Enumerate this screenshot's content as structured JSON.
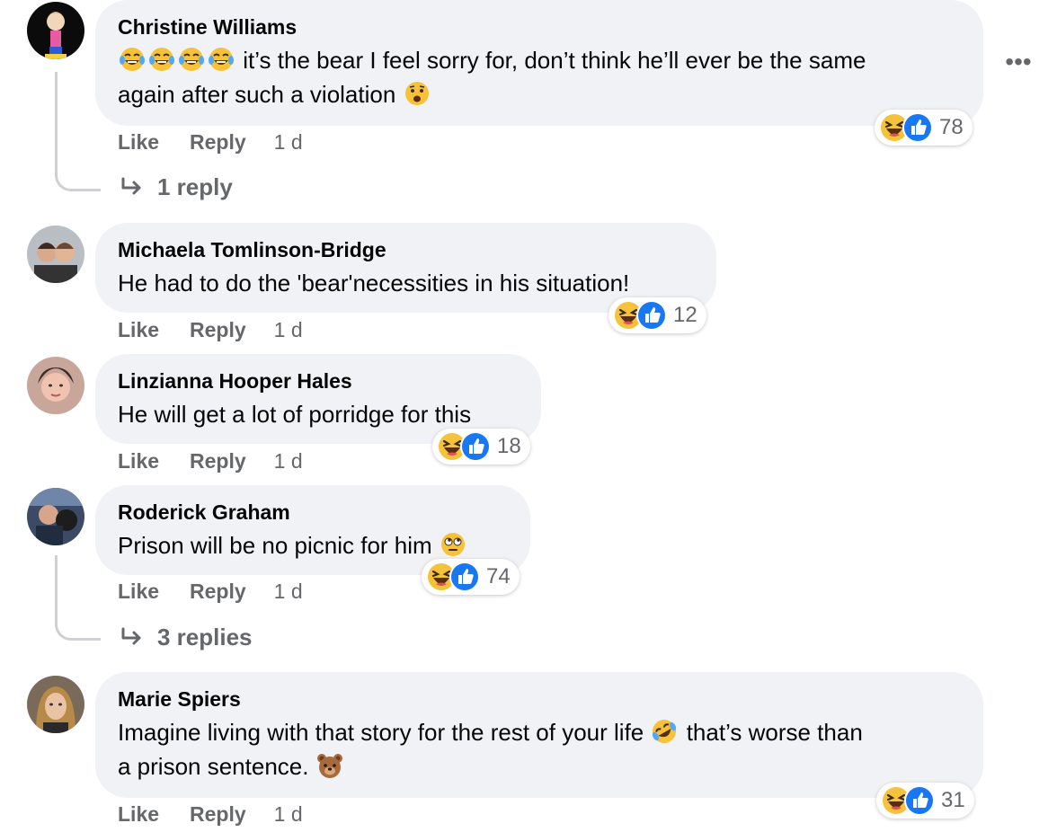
{
  "comments": [
    {
      "author": "Christine Williams",
      "text_emoji_prefix": "😂😂😂😂",
      "text_line1": " it’s the bear I feel sorry for, don’t think he’ll ever be the same",
      "text_line2": "again after such a violation ",
      "text_emoji_suffix": "😧",
      "reaction_count": "78",
      "like_label": "Like",
      "reply_label": "Reply",
      "time": "1 d",
      "replies_label": "1 reply"
    },
    {
      "author": "Michaela Tomlinson-Bridge",
      "text": "He had to do the 'bear'necessities in his situation!",
      "reaction_count": "12",
      "like_label": "Like",
      "reply_label": "Reply",
      "time": "1 d"
    },
    {
      "author": "Linzianna Hooper Hales",
      "text": "He will get a lot of porridge for this",
      "reaction_count": "18",
      "like_label": "Like",
      "reply_label": "Reply",
      "time": "1 d"
    },
    {
      "author": "Roderick Graham",
      "text": "Prison will be no picnic for him ",
      "text_emoji_suffix": "🙄",
      "reaction_count": "74",
      "like_label": "Like",
      "reply_label": "Reply",
      "time": "1 d",
      "replies_label": "3 replies"
    },
    {
      "author": "Marie Spiers",
      "text_line1": "Imagine living with that story for the rest of your life ",
      "text_emoji_mid": "🤣",
      "text_line1b": " that’s worse than",
      "text_line2": "a prison sentence. ",
      "text_emoji_suffix": "🐻",
      "reaction_count": "31",
      "like_label": "Like",
      "reply_label": "Reply",
      "time": "1 d"
    }
  ],
  "icons": {
    "more": "more-horizontal-icon",
    "reply_arrow": "reply-arrow-icon",
    "haha": "haha-reaction-icon",
    "like": "like-reaction-icon"
  },
  "colors": {
    "bubble": "#f0f2f5",
    "meta": "#65676b",
    "like_blue": "#1877f2",
    "haha_yellow": "#f7b928"
  }
}
